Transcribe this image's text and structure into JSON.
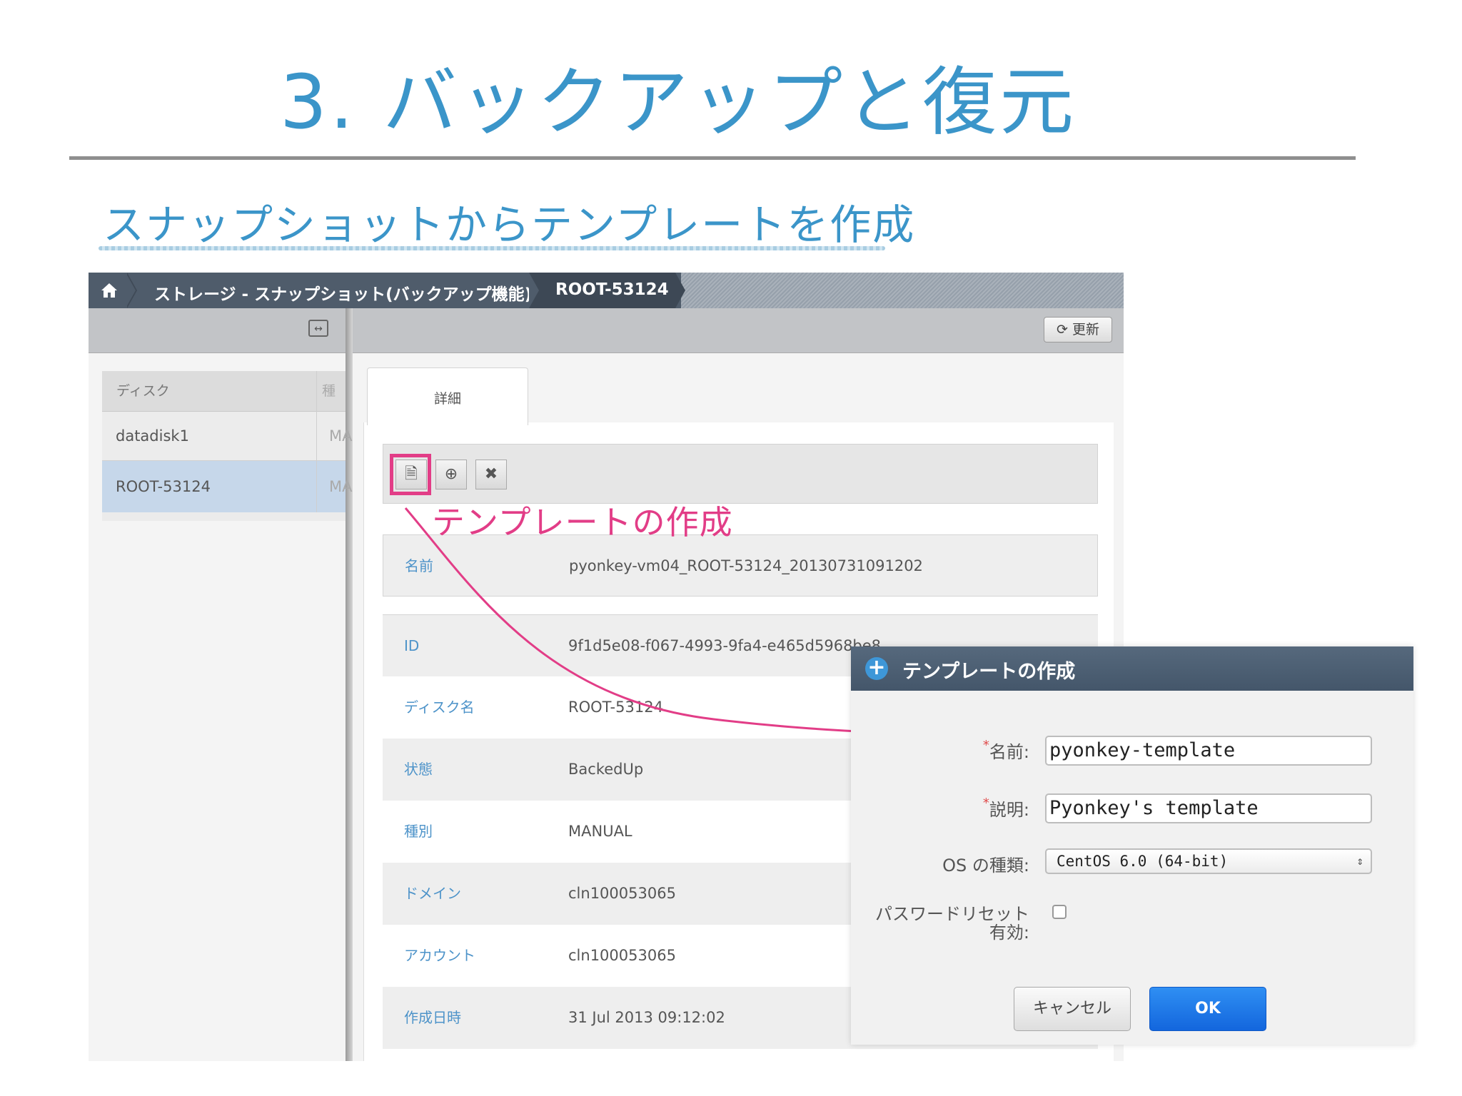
{
  "slide": {
    "title": "3. バックアップと復元",
    "subtitle": "スナップショットからテンプレートを作成"
  },
  "breadcrumb": {
    "home_icon": "home-icon",
    "section": "ストレージ - スナップショット(バックアップ機能)",
    "current": "ROOT-53124"
  },
  "toolbar": {
    "refresh_label": "更新",
    "refresh_icon": "refresh-icon"
  },
  "disk_table": {
    "headers": [
      "ディスク",
      "種別"
    ],
    "rows": [
      {
        "disk": "datadisk1",
        "type": "MA"
      },
      {
        "disk": "ROOT-53124",
        "type": "MA"
      }
    ]
  },
  "detail": {
    "tab_label": "詳細",
    "actions": [
      "create-template-icon",
      "add-icon",
      "delete-icon"
    ],
    "fields": [
      {
        "label": "名前",
        "value": "pyonkey-vm04_ROOT-53124_20130731091202"
      },
      {
        "label": "ID",
        "value": "9f1d5e08-f067-4993-9fa4-e465d5968be8"
      },
      {
        "label": "ディスク名",
        "value": "ROOT-53124"
      },
      {
        "label": "状態",
        "value": "BackedUp"
      },
      {
        "label": "種別",
        "value": "MANUAL"
      },
      {
        "label": "ドメイン",
        "value": "cln100053065"
      },
      {
        "label": "アカウント",
        "value": "cln100053065"
      },
      {
        "label": "作成日時",
        "value": "31 Jul 2013 09:12:02"
      }
    ]
  },
  "annotation": {
    "label": "テンプレートの作成",
    "color": "#e23d87"
  },
  "dialog": {
    "title": "テンプレートの作成",
    "name_label": "名前:",
    "name_value": "pyonkey-template",
    "desc_label": "説明:",
    "desc_value": "Pyonkey's template",
    "os_label": "OS の種類:",
    "os_value": "CentOS 6.0 (64-bit)",
    "password_label_1": "パスワードリセット",
    "password_label_2": "有効:",
    "password_checked": false,
    "cancel_label": "キャンセル",
    "ok_label": "OK"
  },
  "colors": {
    "accent_blue": "#3b95c9",
    "header_bar": "#4f5c6b",
    "ok_button": "#1a73e8",
    "highlight": "#e23d87"
  }
}
